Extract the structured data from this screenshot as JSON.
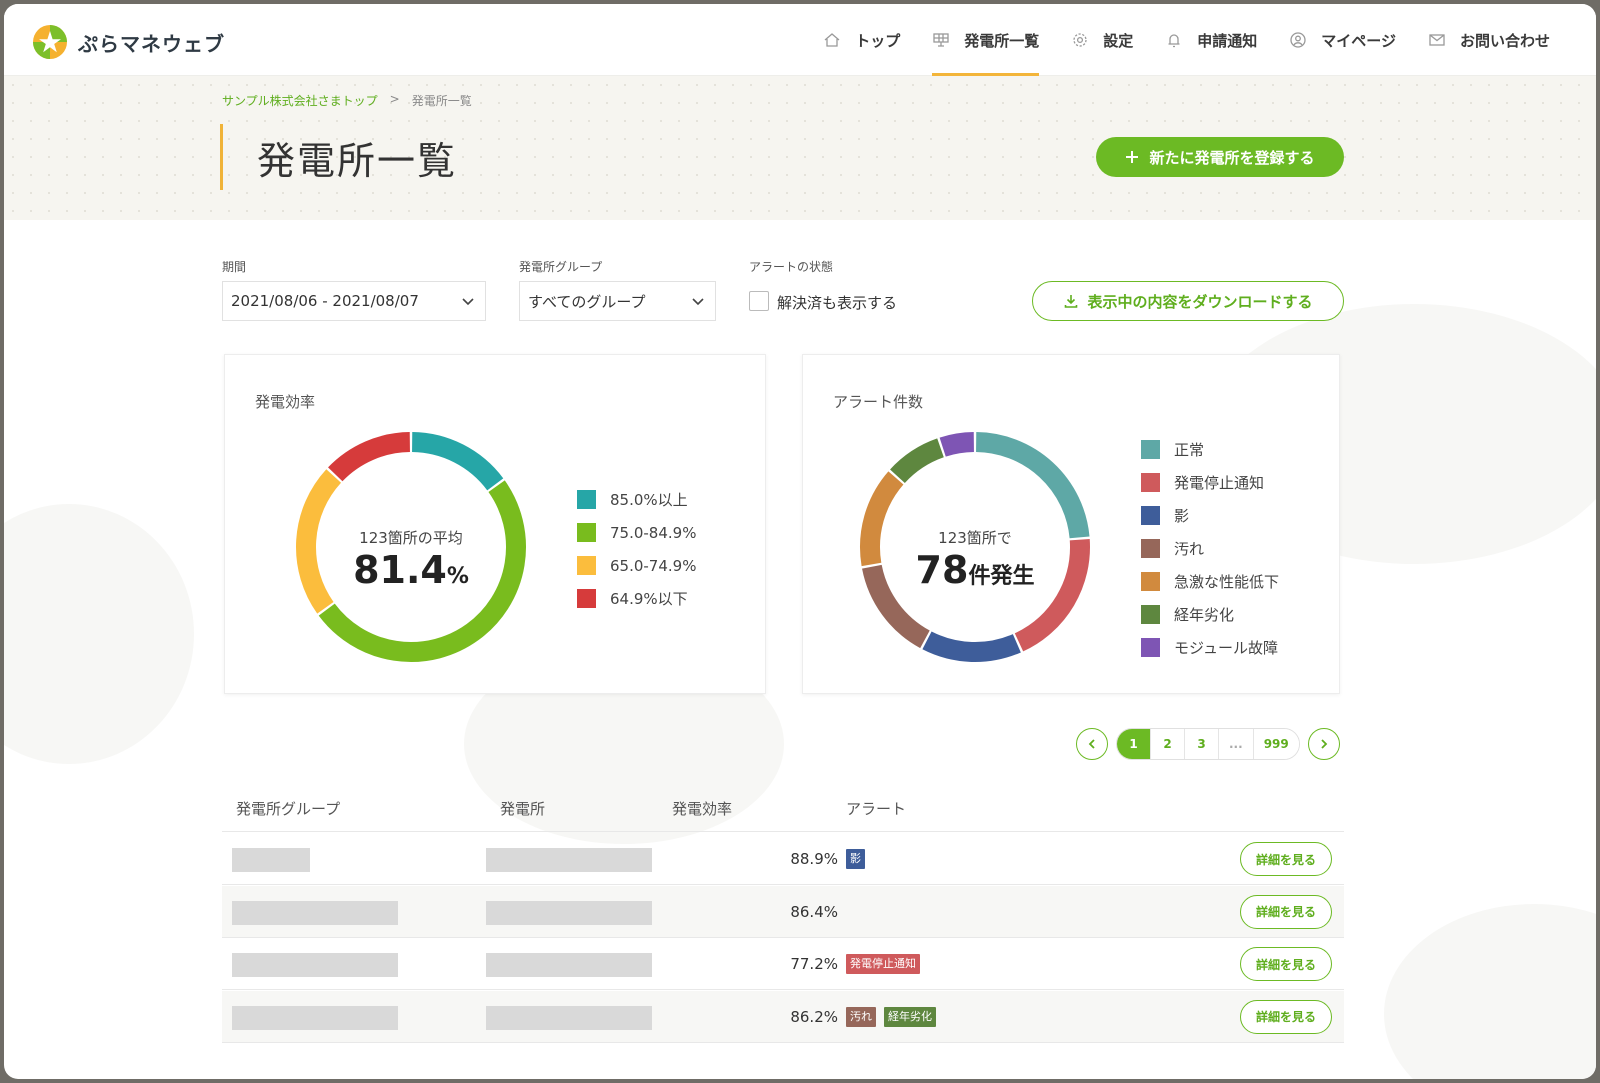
{
  "app": {
    "name": "ぷらマネウェブ"
  },
  "nav": [
    {
      "label": "トップ",
      "icon": "home-icon"
    },
    {
      "label": "発電所一覧",
      "icon": "solar-panel-icon",
      "active": true
    },
    {
      "label": "設定",
      "icon": "gear-icon"
    },
    {
      "label": "申請通知",
      "icon": "bell-icon"
    },
    {
      "label": "マイページ",
      "icon": "user-icon"
    },
    {
      "label": "お問い合わせ",
      "icon": "mail-icon"
    }
  ],
  "breadcrumb": {
    "home": "サンプル株式会社さまトップ",
    "separator": ">",
    "current": "発電所一覧"
  },
  "page_title": "発電所一覧",
  "register_button": "新たに発電所を登録する",
  "filters": {
    "period_label": "期間",
    "period_value": "2021/08/06 - 2021/08/07",
    "group_label": "発電所グループ",
    "group_value": "すべてのグループ",
    "alert_label": "アラートの状態",
    "show_resolved_label": "解決済も表示する",
    "show_resolved_checked": false,
    "download_button": "表示中の内容をダウンロードする"
  },
  "efficiency_card": {
    "title": "発電効率",
    "center_caption": "123箇所の平均",
    "center_value": "81.4",
    "center_unit": "%"
  },
  "alert_card": {
    "title": "アラート件数",
    "center_caption": "123箇所で",
    "center_value": "78",
    "center_unit": "件発生"
  },
  "chart_data": [
    {
      "type": "pie",
      "variant": "donut",
      "labels": [
        "85.0%以上",
        "75.0-84.9%",
        "65.0-74.9%",
        "64.9%以下"
      ],
      "values": [
        15,
        50,
        22,
        13
      ],
      "colors": [
        "#26a6a7",
        "#79bc1e",
        "#fbbd3d",
        "#d63b3b"
      ]
    },
    {
      "type": "pie",
      "variant": "donut",
      "labels": [
        "正常",
        "発電停止通知",
        "影",
        "汚れ",
        "急激な性能低下",
        "経年劣化",
        "モジュール故障"
      ],
      "values": [
        23,
        19,
        14,
        14,
        14,
        8,
        5
      ],
      "colors": [
        "#5ea8a6",
        "#cf5a5c",
        "#3e5d9a",
        "#96675a",
        "#d18a3e",
        "#5e873f",
        "#7e55b4"
      ]
    }
  ],
  "pagination": {
    "pages": [
      "1",
      "2",
      "3",
      "...",
      "999"
    ],
    "current": "1"
  },
  "table": {
    "headers": [
      "発電所グループ",
      "発電所",
      "発電効率",
      "アラート"
    ],
    "detail_label": "詳細を見る",
    "rows": [
      {
        "efficiency": "88.9%",
        "tags": [
          {
            "text": "影",
            "color": "#3e5d9a"
          }
        ]
      },
      {
        "efficiency": "86.4%",
        "tags": []
      },
      {
        "efficiency": "77.2%",
        "tags": [
          {
            "text": "発電停止通知",
            "color": "#cf5a5c"
          }
        ]
      },
      {
        "efficiency": "86.2%",
        "tags": [
          {
            "text": "汚れ",
            "color": "#96675a"
          },
          {
            "text": "経年劣化",
            "color": "#5e873f"
          }
        ]
      }
    ]
  }
}
